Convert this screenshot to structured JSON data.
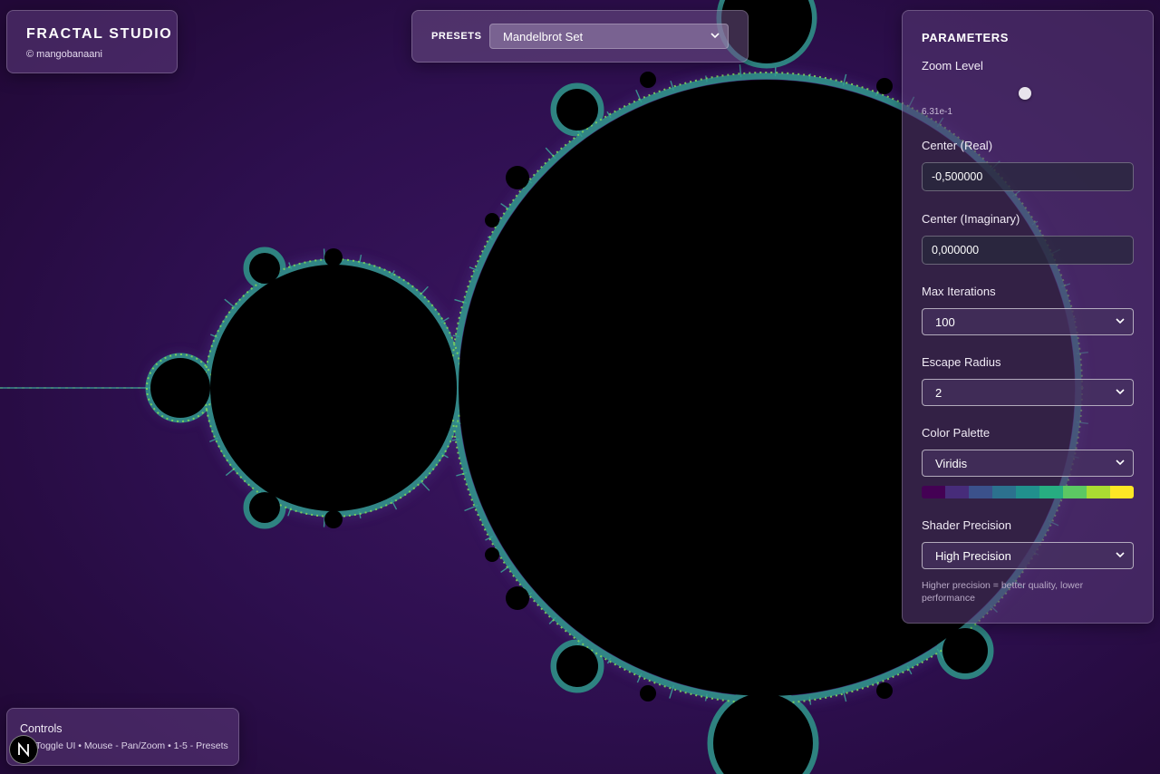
{
  "brand": {
    "title": "FRACTAL STUDIO",
    "copyright": "© mangobanaani"
  },
  "presets": {
    "label": "PRESETS",
    "selected": "Mandelbrot Set"
  },
  "parameters": {
    "title": "PARAMETERS",
    "zoom": {
      "label": "Zoom Level",
      "value_text": "6.31e-1"
    },
    "center_real": {
      "label": "Center (Real)",
      "value": "-0,500000"
    },
    "center_imag": {
      "label": "Center (Imaginary)",
      "value": "0,000000"
    },
    "max_iterations": {
      "label": "Max Iterations",
      "selected": "100"
    },
    "escape_radius": {
      "label": "Escape Radius",
      "selected": "2"
    },
    "color_palette": {
      "label": "Color Palette",
      "selected": "Viridis",
      "swatches": [
        "#440154",
        "#472c7a",
        "#3b518b",
        "#2c718e",
        "#21908d",
        "#27ad81",
        "#5cc863",
        "#aadc32",
        "#fde725"
      ]
    },
    "shader_precision": {
      "label": "Shader Precision",
      "selected": "High Precision",
      "help": "Higher precision = better quality, lower performance"
    }
  },
  "controls": {
    "title": "Controls",
    "text": "Toggle UI • Mouse - Pan/Zoom • 1-5 - Presets"
  },
  "badge": {
    "letter": "N"
  },
  "colors": {
    "background": "#2c0e4c",
    "set_interior": "#000000",
    "edge_teal": "#2a9a8a",
    "edge_green": "#6fd06a"
  }
}
